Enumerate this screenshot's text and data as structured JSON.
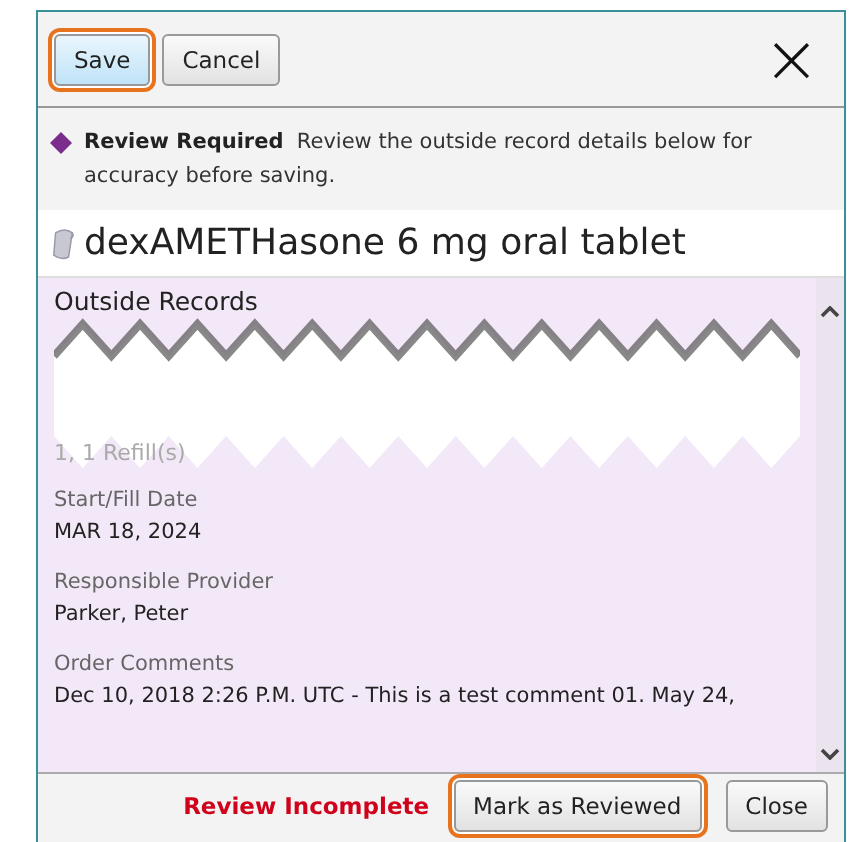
{
  "toolbar": {
    "buttons": [
      {
        "label": "Save",
        "kind": "primary",
        "highlighted": true
      },
      {
        "label": "Cancel",
        "kind": "default",
        "highlighted": false
      }
    ],
    "close_icon": "×"
  },
  "banner": {
    "title": "Review Required",
    "message": "Review the outside record details below for accuracy before saving."
  },
  "medication": {
    "name": "dexAMETHasone 6 mg oral tablet"
  },
  "outside_records": {
    "heading": "Outside Records",
    "refills": "1, 1 Refill(s)",
    "fields": [
      {
        "label": "Start/Fill Date",
        "value": "MAR 18, 2024"
      },
      {
        "label": "Responsible Provider",
        "value": "Parker, Peter"
      },
      {
        "label": "Order Comments",
        "value": "Dec 10, 2018 2:26 P.M. UTC - This is a test comment 01. May 24,"
      }
    ]
  },
  "footer": {
    "status": "Review Incomplete",
    "buttons": [
      {
        "label": "Mark as Reviewed",
        "highlighted": true
      },
      {
        "label": "Close",
        "highlighted": false
      }
    ]
  }
}
